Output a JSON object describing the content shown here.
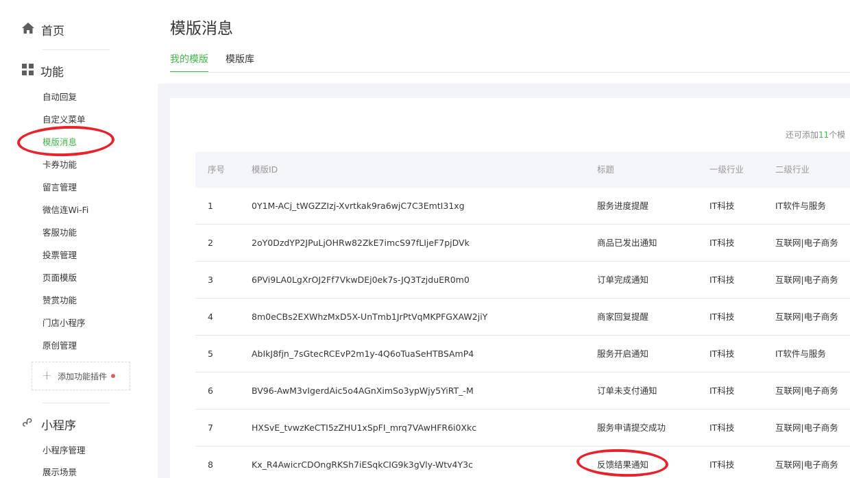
{
  "sidebar": {
    "home_label": "首页",
    "feature_label": "功能",
    "items": [
      {
        "label": "自动回复",
        "active": false
      },
      {
        "label": "自定义菜单",
        "active": false
      },
      {
        "label": "模版消息",
        "active": true
      },
      {
        "label": "卡券功能",
        "active": false
      },
      {
        "label": "留言管理",
        "active": false
      },
      {
        "label": "微信连Wi-Fi",
        "active": false
      },
      {
        "label": "客服功能",
        "active": false
      },
      {
        "label": "投票管理",
        "active": false
      },
      {
        "label": "页面模版",
        "active": false
      },
      {
        "label": "赞赏功能",
        "active": false
      },
      {
        "label": "门店小程序",
        "active": false
      },
      {
        "label": "原创管理",
        "active": false
      }
    ],
    "add_plugin_label": "添加功能插件",
    "miniprogram_label": "小程序",
    "miniprogram_items": [
      {
        "label": "小程序管理"
      },
      {
        "label": "展示场景"
      }
    ]
  },
  "page": {
    "title": "模版消息",
    "tabs": [
      {
        "label": "我的模版",
        "active": true
      },
      {
        "label": "模版库",
        "active": false
      }
    ],
    "quota_prefix": "还可添加",
    "quota_count": "11",
    "quota_suffix": "个模"
  },
  "table": {
    "headers": {
      "no": "序号",
      "id": "模版ID",
      "title": "标题",
      "industry1": "一级行业",
      "industry2": "二级行业"
    },
    "rows": [
      {
        "no": "1",
        "id": "0Y1M-ACj_tWGZZIzj-Xvrtkak9ra6wjC7C3EmtI31xg",
        "title": "服务进度提醒",
        "industry1": "IT科技",
        "industry2": "IT软件与服务"
      },
      {
        "no": "2",
        "id": "2oY0DzdYP2JPuLjOHRw82ZkE7imcS97fLIjeF7pjDVk",
        "title": "商品已发出通知",
        "industry1": "IT科技",
        "industry2": "互联网|电子商务"
      },
      {
        "no": "3",
        "id": "6PVi9LA0LgXrOJ2Ff7VkwDEj0ek7s-JQ3TzjduER0m0",
        "title": "订单完成通知",
        "industry1": "IT科技",
        "industry2": "互联网|电子商务"
      },
      {
        "no": "4",
        "id": "8m0eCBs2EXWhzMxD5X-UnTmb1JrPtVqMKPFGXAW2jiY",
        "title": "商家回复提醒",
        "industry1": "IT科技",
        "industry2": "互联网|电子商务"
      },
      {
        "no": "5",
        "id": "AbIkJ8fjn_7sGtecRCEvP2m1y-4Q6oTuaSeHTBSAmP4",
        "title": "服务开启通知",
        "industry1": "IT科技",
        "industry2": "IT软件与服务"
      },
      {
        "no": "6",
        "id": "BV96-AwM3vIgerdAic5o4AGnXimSo3ypWjy5YiRT_-M",
        "title": "订单未支付通知",
        "industry1": "IT科技",
        "industry2": "互联网|电子商务"
      },
      {
        "no": "7",
        "id": "HXSvE_tvwzKeCTI5zZHU1xSpFI_mrq7VAwHFR6i0Xkc",
        "title": "服务申请提交成功",
        "industry1": "IT科技",
        "industry2": "互联网|电子商务"
      },
      {
        "no": "8",
        "id": "Kx_R4AwicrCDOngRKSh7iESqkCIG9k3gVly-Wtv4Y3c",
        "title": "反馈结果通知",
        "industry1": "IT科技",
        "industry2": "互联网|电子商务"
      }
    ]
  },
  "colors": {
    "accent": "#44b549",
    "annotation": "#e8212b",
    "notify_dot": "#e15f63"
  }
}
